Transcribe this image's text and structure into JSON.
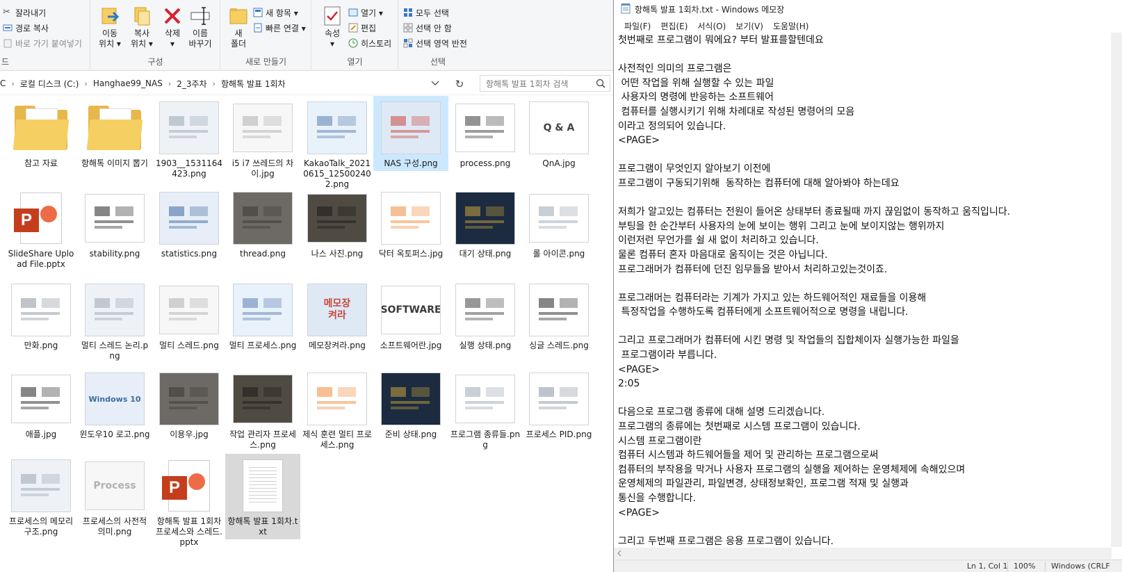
{
  "ribbon": {
    "clipboard": {
      "cut": "잘라내기",
      "copy_path": "경로 복사",
      "paste_shortcut": "바로 가기 붙여넣기",
      "group_fragment": "드"
    },
    "organize": {
      "move_to": "이동\n위치 ▾",
      "copy_to": "복사\n위치 ▾",
      "delete": "삭제\n▾",
      "rename": "이름\n바꾸기",
      "group": "구성"
    },
    "new": {
      "new_folder": "새\n폴더",
      "new_item": "새 항목 ▾",
      "easy_access": "빠른 연결 ▾",
      "group": "새로 만들기"
    },
    "open": {
      "properties": "속성\n▾",
      "open": "열기 ▾",
      "edit": "편집",
      "history": "히스토리",
      "group": "열기"
    },
    "select": {
      "select_all": "모두 선택",
      "select_none": "선택 안 함",
      "invert": "선택 영역 반전",
      "group": "선택"
    }
  },
  "address": {
    "crumbs": [
      "C",
      "로컬 디스크 (C:)",
      "Hanghae99_NAS",
      "2_3주차",
      "항해톡 발표 1회차"
    ],
    "search_placeholder": "항해톡 발표 1회차 검색"
  },
  "files": [
    {
      "name": "참고 자료",
      "kind": "folder"
    },
    {
      "name": "항해톡 이미지 뽑기",
      "kind": "folder"
    },
    {
      "name": "1903__1531164423.png",
      "kind": "image"
    },
    {
      "name": "i5 i7 쓰레드의 차이.jpg",
      "kind": "image"
    },
    {
      "name": "KakaoTalk_20210615_125002402.png",
      "kind": "image"
    },
    {
      "name": "NAS 구성.png",
      "kind": "image",
      "selected": true
    },
    {
      "name": "process.png",
      "kind": "image"
    },
    {
      "name": "QnA.jpg",
      "kind": "image",
      "thumb_text": "Q & A"
    },
    {
      "name": "SlideShare Upload File.pptx",
      "kind": "pptx"
    },
    {
      "name": "stability.png",
      "kind": "image"
    },
    {
      "name": "statistics.png",
      "kind": "image"
    },
    {
      "name": "thread.png",
      "kind": "image"
    },
    {
      "name": "나스 사진.png",
      "kind": "image"
    },
    {
      "name": "닥터 옥토퍼스.jpg",
      "kind": "image"
    },
    {
      "name": "대기 상태.png",
      "kind": "image"
    },
    {
      "name": "롤 아이콘.png",
      "kind": "image"
    },
    {
      "name": "만화.png",
      "kind": "image"
    },
    {
      "name": "멀티 스레드 논리.png",
      "kind": "image"
    },
    {
      "name": "멀티 스레드.png",
      "kind": "image"
    },
    {
      "name": "멀티 프로세스.png",
      "kind": "image"
    },
    {
      "name": "메모장켜라.png",
      "kind": "image",
      "thumb_text": "메모장\n켜라"
    },
    {
      "name": "소프트웨어란.jpg",
      "kind": "image",
      "thumb_text": "SOFTWARE"
    },
    {
      "name": "실행 상태.png",
      "kind": "image"
    },
    {
      "name": "싱글 스레드.png",
      "kind": "image"
    },
    {
      "name": "애플.jpg",
      "kind": "image"
    },
    {
      "name": "윈도우10 로고.png",
      "kind": "image",
      "thumb_text": "Windows 10"
    },
    {
      "name": "이용우.jpg",
      "kind": "image"
    },
    {
      "name": "작업 관리자 프로세스.png",
      "kind": "image"
    },
    {
      "name": "제식 훈련 멀티 프로세스.png",
      "kind": "image"
    },
    {
      "name": "준비 상태.png",
      "kind": "image"
    },
    {
      "name": "프로그램 종류들.png",
      "kind": "image"
    },
    {
      "name": "프로세스 PID.png",
      "kind": "image"
    },
    {
      "name": "프로세스의 메모리 구조.png",
      "kind": "image"
    },
    {
      "name": "프로세스의 사전적 의미.png",
      "kind": "image",
      "thumb_text": "Process"
    },
    {
      "name": "항해톡 발표 1회차 프로세스와 스레드.pptx",
      "kind": "pptx"
    },
    {
      "name": "항해톡 발표 1회차.txt",
      "kind": "txt",
      "selected_gray": true
    }
  ],
  "notepad": {
    "title": "항해톡 발표 1회차.txt - Windows 메모장",
    "menu": [
      "파일(F)",
      "편집(E)",
      "서식(O)",
      "보기(V)",
      "도움말(H)"
    ],
    "lines": [
      "첫번째로 프로그램이 뭐에요? 부터 발표를할텐데요",
      "",
      "사전적인 의미의 프로그램은",
      " 어떤 작업을 위해 실행할 수 있는 파일",
      " 사용자의 명령에 반응하는 소프트웨어",
      " 컴퓨터를 실행시키기 위해 차례대로 작성된 명령어의 모음",
      "이라고 정의되어 있습니다.",
      "<PAGE>",
      "",
      "프로그램이 무엇인지 알아보기 이전에",
      "프로그램이 구동되기위해  동작하는 컴퓨터에 대해 알아봐야 하는데요",
      "",
      "저희가 알고있는 컴퓨터는 전원이 들어온 상태부터 종료될때 까지 끊임없이 동작하고 움직입니다.",
      "부팅을 한 순간부터 사용자의 눈에 보이는 행위 그리고 눈에 보이지않는 행위까지",
      "이런저런 무언가를 쉴 새 없이 처리하고 있습니다.",
      "물론 컴퓨터 혼자 마음대로 움직이는 것은 아닙니다.",
      "프로그래머가 컴퓨터에 던진 임무들을 받아서 처리하고있는것이죠.",
      "",
      "프로그래머는 컴퓨터라는 기계가 가지고 있는 하드웨어적인 재료들을 이용해",
      " 특정작업을 수행하도록 컴퓨터에게 소프트웨어적으로 명령을 내립니다.",
      "",
      "그리고 프로그래머가 컴퓨터에 시킨 명령 및 작업들의 집합체이자 실행가능한 파일을",
      " 프로그램이라 부릅니다.",
      "<PAGE>",
      "2:05",
      "",
      "다음으로 프로그램 종류에 대해 설명 드리겠습니다.",
      "프로그램의 종류에는 첫번째로 시스템 프로그램이 있습니다.",
      "시스템 프로그램이란",
      "컴퓨터 시스템과 하드웨어들을 제어 및 관리하는 프로그램으로써",
      "컴퓨터의 부작용을 막거나 사용자 프로그램의 실행을 제어하는 운영체제에 속해있으며",
      "운영체제의 파일관리, 파일변경, 상태정보확인, 프로그램 적재 및 실행과",
      "통신을 수행합니다.",
      "<PAGE>",
      "",
      "그리고 두번째 프로그램은 응용 프로그램이 있습니다."
    ],
    "status": {
      "position": "Ln 1, Col 1",
      "zoom": "100%",
      "encoding": "Windows (CRLF"
    }
  }
}
